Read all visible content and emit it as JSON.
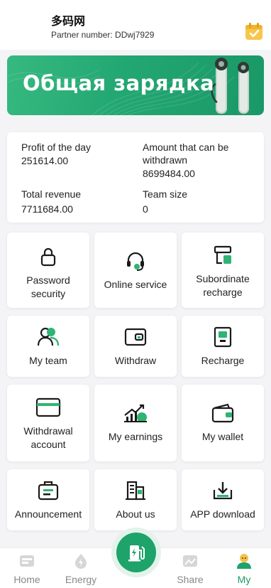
{
  "header": {
    "app_title": "多码网",
    "partner_label": "Partner number: DDwj7929",
    "checkin_icon": "calendar-check-icon"
  },
  "banner": {
    "text": "Общая зарядка"
  },
  "stats": {
    "profit_label": "Profit of the day",
    "profit_value": "251614.00",
    "withdrawable_label": "Amount that can be withdrawn",
    "withdrawable_value": "8699484.00",
    "revenue_label": "Total revenue",
    "revenue_value": "7711684.00",
    "team_label": "Team size",
    "team_value": "0"
  },
  "menu": [
    {
      "label": "Password security",
      "icon": "lock-icon"
    },
    {
      "label": "Online service",
      "icon": "headset-icon"
    },
    {
      "label": "Subordinate recharge",
      "icon": "subordinate-recharge-icon"
    },
    {
      "label": "My team",
      "icon": "team-icon"
    },
    {
      "label": "Withdraw",
      "icon": "wallet-withdraw-icon"
    },
    {
      "label": "Recharge",
      "icon": "recharge-icon"
    },
    {
      "label": "Withdrawal account",
      "icon": "card-icon"
    },
    {
      "label": "My earnings",
      "icon": "earnings-chart-icon"
    },
    {
      "label": "My wallet",
      "icon": "wallet-icon"
    },
    {
      "label": "Announcement",
      "icon": "announcement-icon"
    },
    {
      "label": "About us",
      "icon": "building-icon"
    },
    {
      "label": "APP download",
      "icon": "download-icon"
    }
  ],
  "tabbar": {
    "home": "Home",
    "energy": "Energy",
    "share": "Share",
    "my": "My",
    "center_icon": "charging-station-icon",
    "active_color": "#1d9a63"
  },
  "colors": {
    "accent": "#1ea36a",
    "icon_green": "#2fb474",
    "icon_dark": "#1a1a1a"
  }
}
